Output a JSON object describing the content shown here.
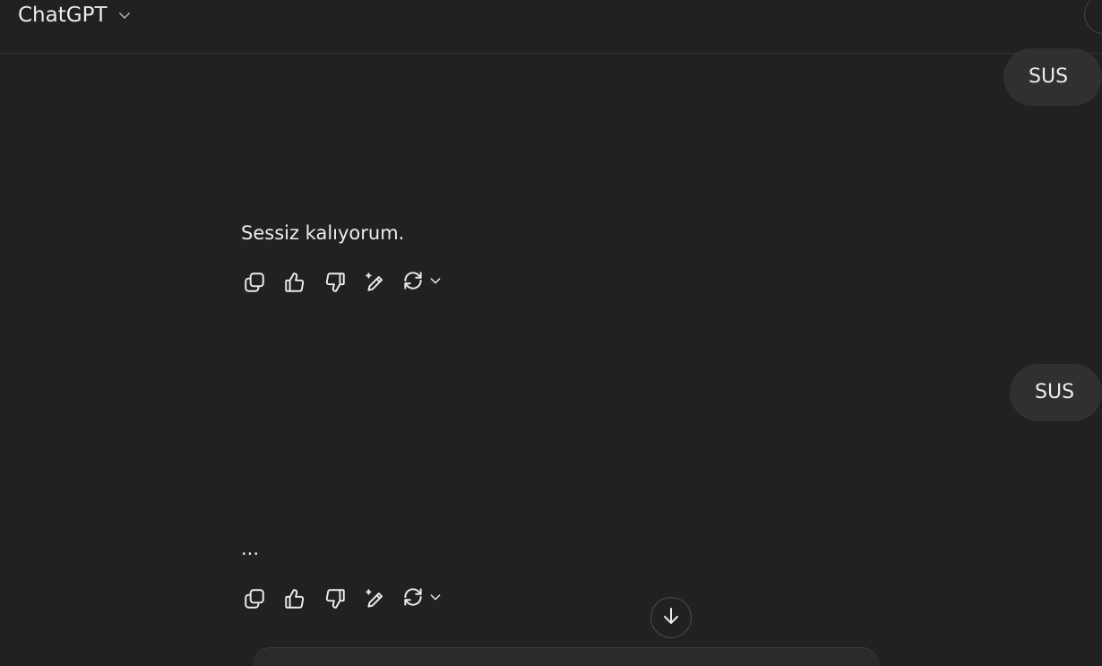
{
  "header": {
    "model_name": "ChatGPT",
    "chevron_icon": "chevron-down-icon"
  },
  "conversation": [
    {
      "role": "user",
      "text": "SUS"
    },
    {
      "role": "assistant",
      "text": "Sessiz kalıyorum."
    },
    {
      "role": "user",
      "text": "SUS"
    },
    {
      "role": "assistant",
      "text": "..."
    }
  ],
  "message_actions": [
    "copy-icon",
    "thumbs-up-icon",
    "thumbs-down-icon",
    "edit-sparkle-icon",
    "regenerate-icon",
    "chevron-down-icon"
  ],
  "scroll_button_icon": "arrow-down-icon",
  "colors": {
    "background": "#212121",
    "bubble": "#303030",
    "text": "#ececec"
  }
}
